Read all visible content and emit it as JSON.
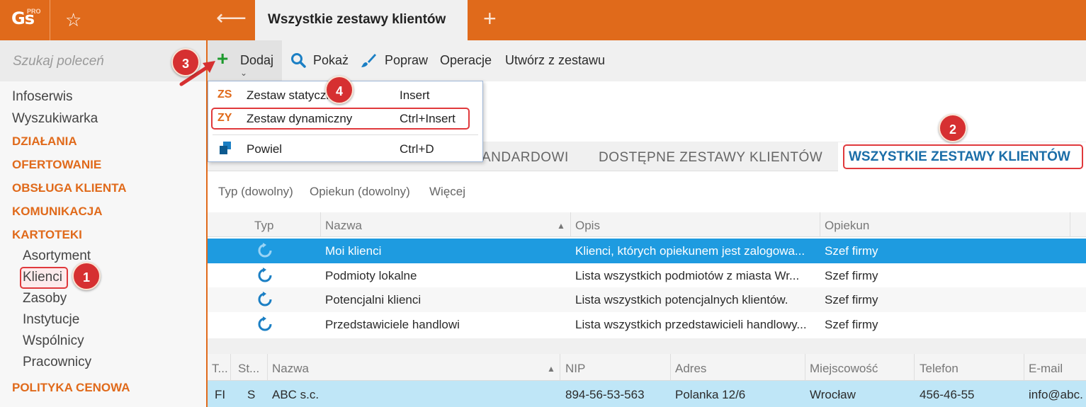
{
  "app": {
    "logo_text": "Gs",
    "logo_badge": "PRO"
  },
  "header": {
    "active_tab": "Wszystkie zestawy klientów"
  },
  "sidebar": {
    "search_placeholder": "Szukaj poleceń",
    "items": [
      "Infoserwis",
      "Wyszukiwarka"
    ],
    "categories": [
      "DZIAŁANIA",
      "OFERTOWANIE",
      "OBSŁUGA KLIENTA",
      "KOMUNIKACJA",
      "KARTOTEKI"
    ],
    "sub_items": [
      "Asortyment",
      "Klienci",
      "Zasoby",
      "Instytucje",
      "Wspólnicy",
      "Pracownicy"
    ],
    "bottom_category": "POLITYKA CENOWA"
  },
  "toolbar": {
    "add": "Dodaj",
    "show": "Pokaż",
    "edit": "Popraw",
    "operations": "Operacje",
    "create_from_set": "Utwórz z zestawu"
  },
  "menu": [
    {
      "icon": "ZS",
      "label": "Zestaw statyczny",
      "shortcut": "Insert"
    },
    {
      "icon": "ZY",
      "label": "Zestaw dynamiczny",
      "shortcut": "Ctrl+Insert"
    },
    {
      "icon": "",
      "label": "Powiel",
      "shortcut": "Ctrl+D"
    }
  ],
  "tabs": {
    "partial": "ANDARDOWI",
    "available": "DOSTĘPNE ZESTAWY KLIENTÓW",
    "all": "WSZYSTKIE ZESTAWY KLIENTÓW"
  },
  "filters": [
    "Typ (dowolny)",
    "Opiekun (dowolny)",
    "Więcej"
  ],
  "sets_grid": {
    "headers": [
      "Typ",
      "Nazwa",
      "Opis",
      "Opiekun"
    ],
    "rows": [
      {
        "name": "Moi klienci",
        "desc": "Klienci, których opiekunem jest zalogowa...",
        "owner": "Szef firmy"
      },
      {
        "name": "Podmioty lokalne",
        "desc": "Lista wszystkich podmiotów z miasta Wr...",
        "owner": "Szef firmy"
      },
      {
        "name": "Potencjalni klienci",
        "desc": "Lista wszystkich potencjalnych klientów.",
        "owner": "Szef firmy"
      },
      {
        "name": "Przedstawiciele handlowi",
        "desc": "Lista wszystkich przedstawicieli handlowy...",
        "owner": "Szef firmy"
      }
    ]
  },
  "clients_grid": {
    "headers": [
      "T...",
      "St...",
      "Nazwa",
      "NIP",
      "Adres",
      "Miejscowość",
      "Telefon",
      "E-mail"
    ],
    "row": {
      "t": "FI",
      "st": "S",
      "name": "ABC s.c.",
      "nip": "894-56-53-563",
      "address": "Polanka  12/6",
      "city": "Wrocław",
      "phone": "456-46-55",
      "email": "info@abc."
    }
  },
  "badges": [
    "1",
    "2",
    "3",
    "4"
  ],
  "colors": {
    "accent": "#e06a1b",
    "selection": "#1e9be0",
    "annotation": "#d63031"
  }
}
